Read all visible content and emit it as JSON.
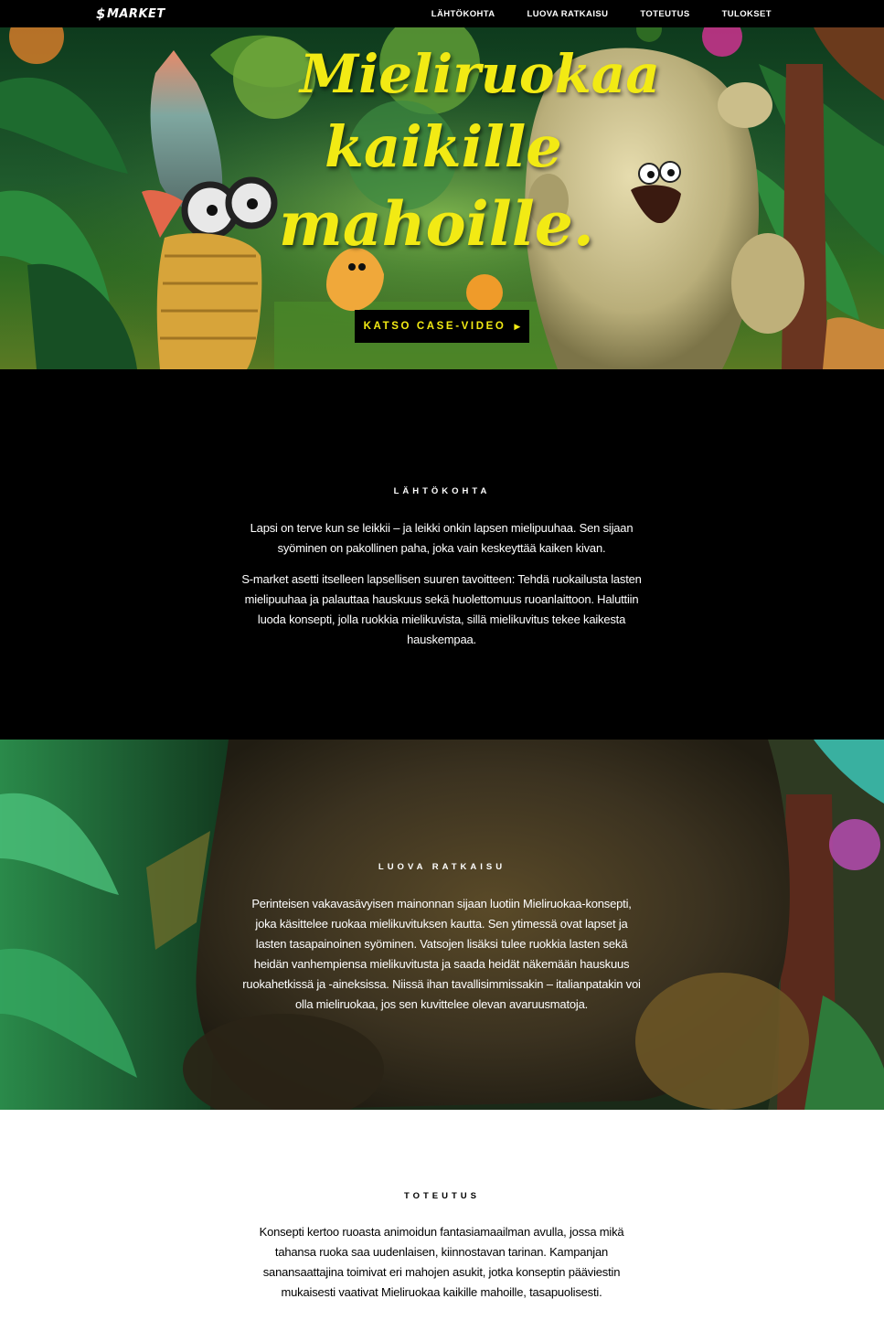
{
  "nav": {
    "logo": "MARKET",
    "links": [
      "LÄHTÖKOHTA",
      "LUOVA RATKAISU",
      "TOTEUTUS",
      "TULOKSET"
    ]
  },
  "hero": {
    "title_lines": [
      "Mieliruokaa",
      "kaikille",
      "mahoille."
    ],
    "cta_label": "KATSO CASE-VIDEO",
    "cta_icon": "play-arrow-icon",
    "title_color": "#f2ea14"
  },
  "lahtokohta": {
    "heading": "LÄHTÖKOHTA",
    "paragraphs": [
      "Lapsi on terve kun se leikkii – ja leikki onkin lapsen mielipuuhaa. Sen sijaan syöminen on pakollinen paha, joka vain keskeyttää kaiken kivan.",
      "S-market asetti itselleen lapsellisen suuren tavoitteen: Tehdä ruokailusta lasten mielipuuhaa ja palauttaa hauskuus sekä huolettomuus ruoanlaittoon. Haluttiin luoda konsepti, jolla ruokkia mielikuvista, sillä mielikuvitus tekee kaikesta hauskempaa."
    ]
  },
  "luova_ratkaisu": {
    "heading": "LUOVA RATKAISU",
    "paragraphs": [
      "Perinteisen vakavasävyisen mainonnan sijaan luotiin Mieliruokaa-konsepti, joka käsittelee ruokaa mielikuvituksen kautta. Sen ytimessä ovat lapset ja lasten tasapainoinen syöminen. Vatsojen lisäksi tulee ruokkia lasten sekä heidän vanhempiensa mielikuvitusta ja saada heidät näkemään hauskuus ruokahetkissä ja -aineksissa. Niissä ihan tavallisimmissakin – italianpatakin voi olla mieliruokaa, jos sen kuvittelee olevan avaruusmatoja."
    ]
  },
  "toteutus": {
    "heading": "TOTEUTUS",
    "paragraphs": [
      "Konsepti kertoo ruoasta animoidun fantasiamaailman avulla, jossa mikä tahansa ruoka saa uudenlaisen, kiinnostavan tarinan. Kampanjan sanansaattajina toimivat eri mahojen asukit, jotka konseptin pääviestin mukaisesti vaativat Mieliruokaa kaikille mahoille, tasapuolisesti."
    ]
  }
}
